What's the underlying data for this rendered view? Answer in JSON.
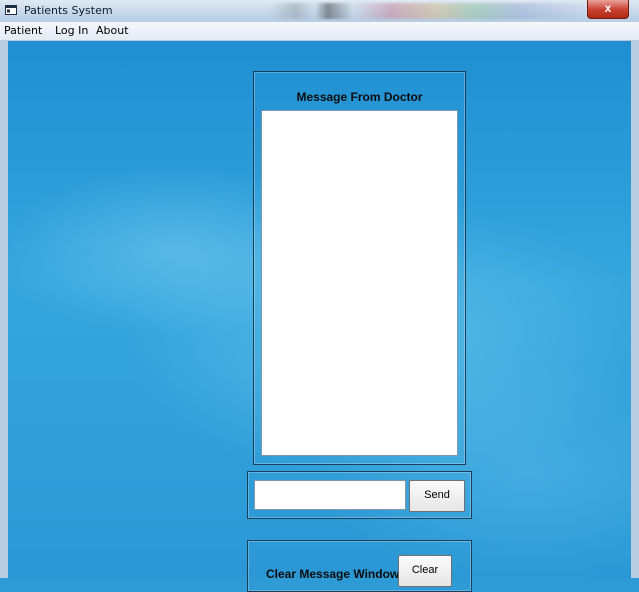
{
  "window": {
    "title": "Patients System",
    "close_glyph": "x"
  },
  "menubar": {
    "items": [
      {
        "label": "Patient"
      },
      {
        "label": "Log In"
      },
      {
        "label": "About"
      }
    ]
  },
  "main": {
    "message_panel_title": "Message From Doctor",
    "message_text": "",
    "send_input_value": "",
    "send_button_label": "Send",
    "clear_label": "Clear Message Window :",
    "clear_button_label": "Clear"
  },
  "icons": {
    "app": "window-app-icon",
    "close": "close-icon"
  },
  "colors": {
    "desktop": "#2e9bd6",
    "close_button": "#c7402e",
    "panel_border": "#1a3e5c"
  }
}
